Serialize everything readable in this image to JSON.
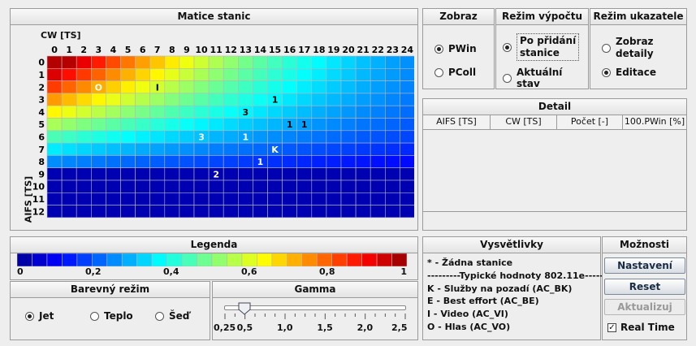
{
  "matrix": {
    "title": "Matice stanic",
    "cw_label": "CW [TS]",
    "aifs_label": "AIFS [TS]",
    "cw_ticks": [
      "0",
      "1",
      "2",
      "3",
      "4",
      "5",
      "6",
      "7",
      "8",
      "9",
      "10",
      "11",
      "12",
      "13",
      "14",
      "15",
      "16",
      "17",
      "18",
      "19",
      "20",
      "21",
      "22",
      "23",
      "24"
    ],
    "aifs_ticks": [
      "0",
      "1",
      "2",
      "3",
      "4",
      "5",
      "6",
      "7",
      "8",
      "9",
      "10",
      "11",
      "12"
    ],
    "markers": [
      {
        "row": 2,
        "col": 3,
        "text": "O"
      },
      {
        "row": 2,
        "col": 7,
        "text": "I"
      },
      {
        "row": 3,
        "col": 15,
        "text": "1"
      },
      {
        "row": 4,
        "col": 13,
        "text": "3"
      },
      {
        "row": 5,
        "col": 16,
        "text": "1"
      },
      {
        "row": 5,
        "col": 17,
        "text": "1"
      },
      {
        "row": 6,
        "col": 10,
        "text": "3"
      },
      {
        "row": 6,
        "col": 13,
        "text": "1"
      },
      {
        "row": 7,
        "col": 15,
        "text": "K"
      },
      {
        "row": 8,
        "col": 14,
        "text": "1"
      },
      {
        "row": 9,
        "col": 11,
        "text": "2"
      }
    ]
  },
  "zobraz": {
    "title": "Zobraz",
    "options": [
      "PWin",
      "PColl"
    ],
    "selected": 0
  },
  "rezim_vypoctu": {
    "title": "Režim výpočtu",
    "option1_l1": "Po přidání",
    "option1_l2": "stanice",
    "option2": "Aktuální stav",
    "selected": 0
  },
  "rezim_ukazatele": {
    "title": "Režim ukazatele",
    "option1_l1": "Zobraz",
    "option1_l2": "detaily",
    "option2": "Editace",
    "selected": 1
  },
  "detail": {
    "title": "Detail",
    "columns": [
      "AIFS [TS]",
      "CW [TS]",
      "Počet [-]",
      "100.PWin [%]"
    ]
  },
  "legenda": {
    "title": "Legenda",
    "ticks": [
      "0",
      "0,2",
      "0,4",
      "0,6",
      "0,8",
      "1"
    ]
  },
  "barevny_rezim": {
    "title": "Barevný režim",
    "options": [
      "Jet",
      "Teplo",
      "Šeď"
    ],
    "selected": 0
  },
  "gamma": {
    "title": "Gamma",
    "ticks": [
      "0,25",
      "0,5",
      "1,0",
      "1,5",
      "2,0",
      "2,5"
    ],
    "value": 0.5
  },
  "vysvetlivky": {
    "title": "Vysvětlivky",
    "lines": [
      "* - Žádna stanice",
      "---------Typické hodnoty 802.11e---------",
      "K - Služby na pozadí (AC_BK)",
      "E - Best effort (AC_BE)",
      "I - Video (AC_VI)",
      "O - Hlas (AC_VO)"
    ]
  },
  "moznosti": {
    "title": "Možnosti",
    "nastaveni": "Nastavení",
    "reset": "Reset",
    "aktualizuj": "Aktualizuj",
    "realtime": "Real Time",
    "realtime_checked": true
  }
}
